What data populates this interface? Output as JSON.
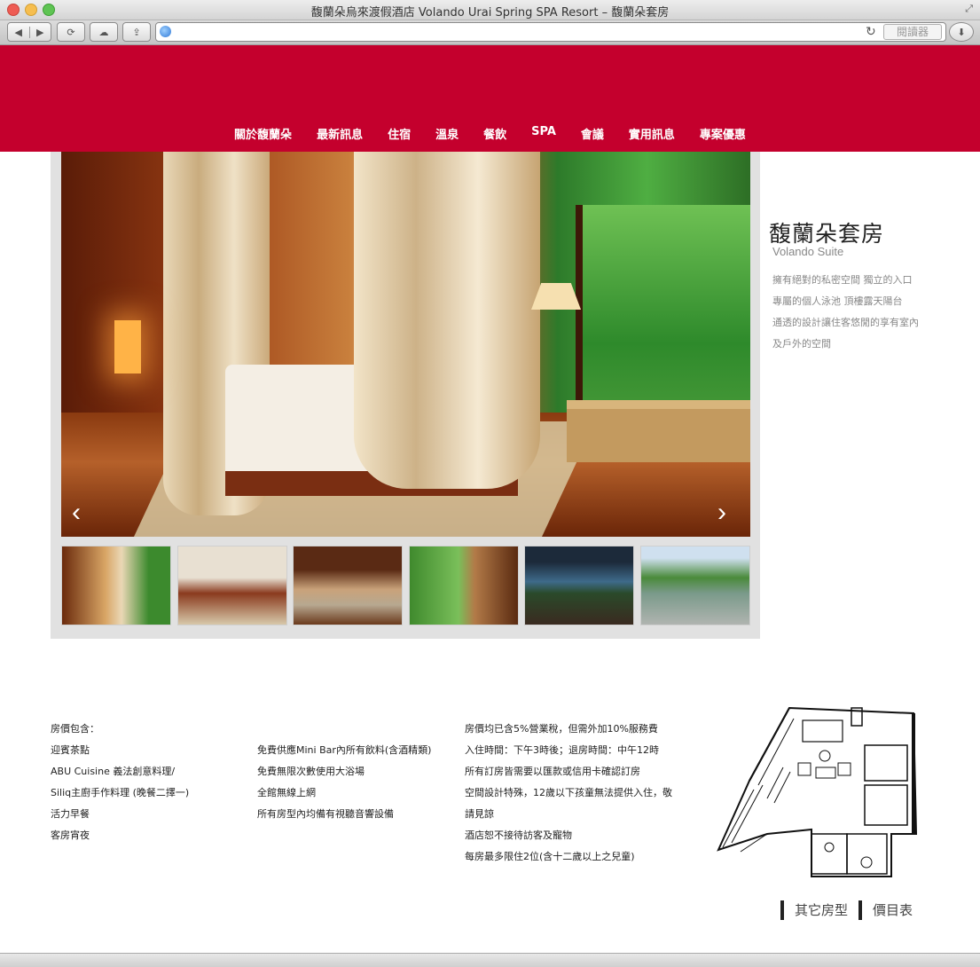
{
  "window": {
    "title": "馥蘭朵烏來渡假酒店 Volando Urai Spring SPA Resort – 馥蘭朵套房"
  },
  "toolbar": {
    "back_glyph": "◀",
    "forward_glyph": "▶",
    "history_glyph": "⟳",
    "icloud_glyph": "☁",
    "share_glyph": "⇪",
    "reload_glyph": "↻",
    "reader_label": "閱讀器",
    "download_glyph": "⬇",
    "url": ""
  },
  "nav": {
    "items": [
      "關於馥蘭朵",
      "最新訊息",
      "住宿",
      "溫泉",
      "餐飲",
      "SPA",
      "會議",
      "實用訊息",
      "專案優惠"
    ]
  },
  "gallery": {
    "prev_glyph": "‹",
    "next_glyph": "›",
    "thumbnail_count": 6
  },
  "room": {
    "title": "馥蘭朵套房",
    "subtitle": "Volando Suite",
    "description": [
      "擁有絕對的私密空間 獨立的入口",
      "專屬的個人泳池 頂樓露天陽台",
      "通透的設計讓住客悠閒的享有室內",
      "及戶外的空間"
    ]
  },
  "info": {
    "col1": [
      "房價包含：",
      "迎賓茶點",
      "ABU Cuisine 義法創意料理/",
      "Siliq主廚手作料理 (晚餐二擇一)",
      "活力早餐",
      "客房宵夜"
    ],
    "col2": [
      "免費供應Mini Bar內所有飲料(含酒精類)",
      "免費無限次數使用大浴場",
      "全館無線上網",
      "所有房型內均備有視聽音響設備"
    ],
    "col3": [
      "房價均已含5%營業稅，但需外加10%服務費",
      "入住時間：下午3時後；退房時間：中午12時",
      "所有訂房皆需要以匯款或信用卡確認訂房",
      "空間設計特殊，12歲以下孩童無法提供入住，敬",
      "請見諒",
      "酒店恕不接待訪客及寵物",
      "每房最多限住2位(含十二歲以上之兒童)"
    ]
  },
  "links": {
    "other_rooms": "其它房型",
    "price_list": "價目表"
  },
  "colors": {
    "brand_red": "#c4002d",
    "gallery_bg": "#e1e1e1"
  }
}
